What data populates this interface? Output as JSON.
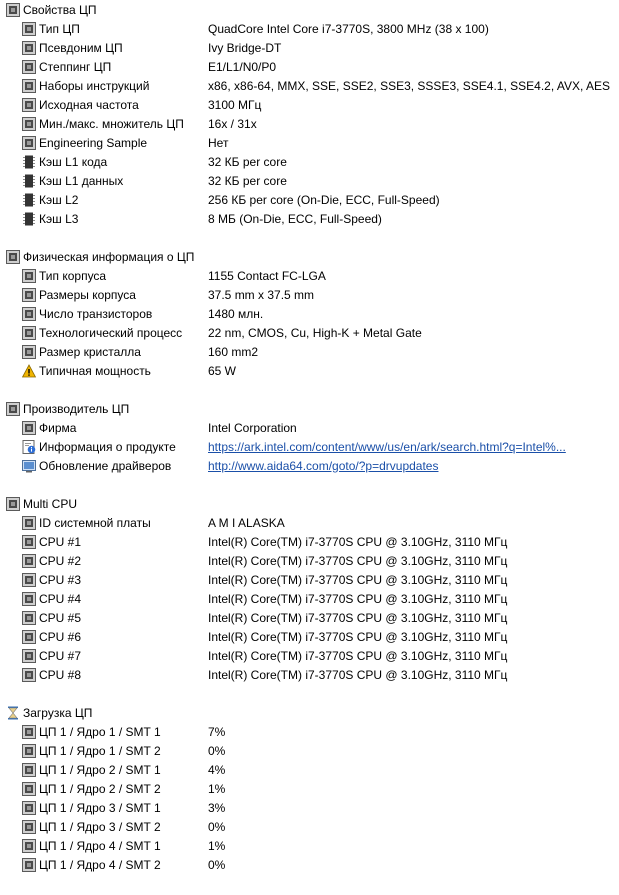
{
  "sections": [
    {
      "title": "Свойства ЦП",
      "icon": "cpu-chip-icon",
      "rows": [
        {
          "label": "Тип ЦП",
          "value": "QuadCore Intel Core i7-3770S, 3800 MHz (38 x 100)",
          "icon": "cpu-chip-icon"
        },
        {
          "label": "Псевдоним ЦП",
          "value": "Ivy Bridge-DT",
          "icon": "cpu-chip-icon"
        },
        {
          "label": "Степпинг ЦП",
          "value": "E1/L1/N0/P0",
          "icon": "cpu-chip-icon"
        },
        {
          "label": "Наборы инструкций",
          "value": "x86, x86-64, MMX, SSE, SSE2, SSE3, SSSE3, SSE4.1, SSE4.2, AVX, AES",
          "icon": "cpu-chip-icon"
        },
        {
          "label": "Исходная частота",
          "value": "3100 МГц",
          "icon": "cpu-chip-icon"
        },
        {
          "label": "Мин./макс. множитель ЦП",
          "value": "16x / 31x",
          "icon": "cpu-chip-icon"
        },
        {
          "label": "Engineering Sample",
          "value": "Нет",
          "icon": "cpu-chip-icon"
        },
        {
          "label": "Кэш L1 кода",
          "value": "32 КБ per core",
          "icon": "memory-chip-icon"
        },
        {
          "label": "Кэш L1 данных",
          "value": "32 КБ per core",
          "icon": "memory-chip-icon"
        },
        {
          "label": "Кэш L2",
          "value": "256 КБ per core  (On-Die, ECC, Full-Speed)",
          "icon": "memory-chip-icon"
        },
        {
          "label": "Кэш L3",
          "value": "8 МБ  (On-Die, ECC, Full-Speed)",
          "icon": "memory-chip-icon"
        }
      ]
    },
    {
      "title": "Физическая информация о ЦП",
      "icon": "cpu-chip-icon",
      "rows": [
        {
          "label": "Тип корпуса",
          "value": "1155 Contact FC-LGA",
          "icon": "cpu-chip-icon"
        },
        {
          "label": "Размеры корпуса",
          "value": "37.5 mm x 37.5 mm",
          "icon": "cpu-chip-icon"
        },
        {
          "label": "Число транзисторов",
          "value": "1480 млн.",
          "icon": "cpu-chip-icon"
        },
        {
          "label": "Технологический процесс",
          "value": "22 nm, CMOS, Cu, High-K + Metal Gate",
          "icon": "cpu-chip-icon"
        },
        {
          "label": "Размер кристалла",
          "value": "160 mm2",
          "icon": "cpu-chip-icon"
        },
        {
          "label": "Типичная мощность",
          "value": "65 W",
          "icon": "warning-icon"
        }
      ]
    },
    {
      "title": "Производитель ЦП",
      "icon": "cpu-chip-icon",
      "rows": [
        {
          "label": "Фирма",
          "value": "Intel Corporation",
          "icon": "cpu-chip-icon"
        },
        {
          "label": "Информация о продукте",
          "value": "https://ark.intel.com/content/www/us/en/ark/search.html?q=Intel%...",
          "icon": "info-icon",
          "link": true
        },
        {
          "label": "Обновление драйверов",
          "value": "http://www.aida64.com/goto/?p=drvupdates",
          "icon": "update-icon",
          "link": true
        }
      ]
    },
    {
      "title": "Multi CPU",
      "icon": "cpu-chip-icon",
      "rows": [
        {
          "label": "ID системной платы",
          "value": "A M I ALASKA",
          "icon": "cpu-chip-icon"
        },
        {
          "label": "CPU #1",
          "value": "Intel(R) Core(TM) i7-3770S CPU @ 3.10GHz, 3110 МГц",
          "icon": "cpu-chip-icon"
        },
        {
          "label": "CPU #2",
          "value": "Intel(R) Core(TM) i7-3770S CPU @ 3.10GHz, 3110 МГц",
          "icon": "cpu-chip-icon"
        },
        {
          "label": "CPU #3",
          "value": "Intel(R) Core(TM) i7-3770S CPU @ 3.10GHz, 3110 МГц",
          "icon": "cpu-chip-icon"
        },
        {
          "label": "CPU #4",
          "value": "Intel(R) Core(TM) i7-3770S CPU @ 3.10GHz, 3110 МГц",
          "icon": "cpu-chip-icon"
        },
        {
          "label": "CPU #5",
          "value": "Intel(R) Core(TM) i7-3770S CPU @ 3.10GHz, 3110 МГц",
          "icon": "cpu-chip-icon"
        },
        {
          "label": "CPU #6",
          "value": "Intel(R) Core(TM) i7-3770S CPU @ 3.10GHz, 3110 МГц",
          "icon": "cpu-chip-icon"
        },
        {
          "label": "CPU #7",
          "value": "Intel(R) Core(TM) i7-3770S CPU @ 3.10GHz, 3110 МГц",
          "icon": "cpu-chip-icon"
        },
        {
          "label": "CPU #8",
          "value": "Intel(R) Core(TM) i7-3770S CPU @ 3.10GHz, 3110 МГц",
          "icon": "cpu-chip-icon"
        }
      ]
    },
    {
      "title": "Загрузка ЦП",
      "icon": "hourglass-icon",
      "rows": [
        {
          "label": "ЦП 1 / Ядро 1 / SMT 1",
          "value": "7%",
          "icon": "cpu-chip-icon"
        },
        {
          "label": "ЦП 1 / Ядро 1 / SMT 2",
          "value": "0%",
          "icon": "cpu-chip-icon"
        },
        {
          "label": "ЦП 1 / Ядро 2 / SMT 1",
          "value": "4%",
          "icon": "cpu-chip-icon"
        },
        {
          "label": "ЦП 1 / Ядро 2 / SMT 2",
          "value": "1%",
          "icon": "cpu-chip-icon"
        },
        {
          "label": "ЦП 1 / Ядро 3 / SMT 1",
          "value": "3%",
          "icon": "cpu-chip-icon"
        },
        {
          "label": "ЦП 1 / Ядро 3 / SMT 2",
          "value": "0%",
          "icon": "cpu-chip-icon"
        },
        {
          "label": "ЦП 1 / Ядро 4 / SMT 1",
          "value": "1%",
          "icon": "cpu-chip-icon"
        },
        {
          "label": "ЦП 1 / Ядро 4 / SMT 2",
          "value": "0%",
          "icon": "cpu-chip-icon"
        }
      ]
    }
  ],
  "colors": {
    "link": "#1a4fa8",
    "chip_body": "#4a4a4a",
    "chip_pin": "#8a8a8a",
    "warning": "#f0b400",
    "info": "#2f6fd6"
  }
}
